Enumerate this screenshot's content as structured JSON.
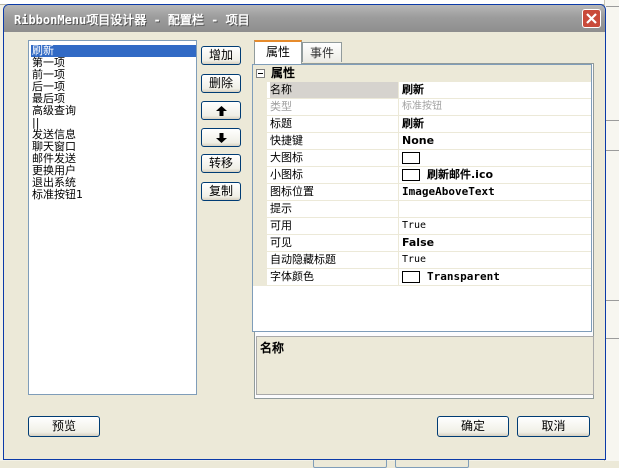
{
  "window": {
    "title": "RibbonMenu项目设计器 - 配置栏 - 项目"
  },
  "items_list": [
    "刷新",
    "第一项",
    "前一项",
    "后一项",
    "最后项",
    "高级查询",
    "||",
    "发送信息",
    "聊天窗口",
    "邮件发送",
    "更换用户",
    "退出系统",
    "标准按钮1"
  ],
  "selected_index": 0,
  "side_buttons": {
    "add": "增加",
    "delete": "删除",
    "move_up_icon": "arrow-up-icon",
    "move_down_icon": "arrow-down-icon",
    "convert": "转移",
    "copy": "复制"
  },
  "tabs": {
    "properties": "属性",
    "events": "事件"
  },
  "property_grid": {
    "category": "属性",
    "rows": [
      {
        "name": "名称",
        "value": "刷新"
      },
      {
        "name": "类型",
        "value": "标准按钮"
      },
      {
        "name": "标题",
        "value": "刷新"
      },
      {
        "name": "快捷键",
        "value": "None"
      },
      {
        "name": "大图标",
        "value": ""
      },
      {
        "name": "小图标",
        "value": "刷新邮件.ico"
      },
      {
        "name": "图标位置",
        "value": "ImageAboveText"
      },
      {
        "name": "提示",
        "value": ""
      },
      {
        "name": "可用",
        "value": "True"
      },
      {
        "name": "可见",
        "value": "False"
      },
      {
        "name": "自动隐藏标题",
        "value": "True"
      },
      {
        "name": "字体颜色",
        "value": "Transparent"
      }
    ]
  },
  "description": {
    "title": "名称"
  },
  "bottom_buttons": {
    "preview": "预览",
    "ok": "确定",
    "cancel": "取消"
  },
  "colors": {
    "selection": "#316ac5",
    "tab_accent": "#e68b2c",
    "close_button": "#c94a3a"
  }
}
